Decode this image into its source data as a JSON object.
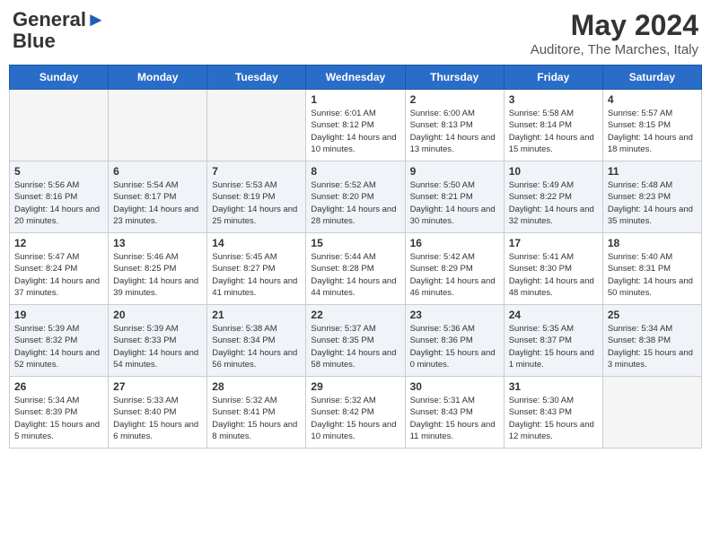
{
  "header": {
    "logo_line1": "General",
    "logo_line2": "Blue",
    "month_year": "May 2024",
    "location": "Auditore, The Marches, Italy"
  },
  "days_of_week": [
    "Sunday",
    "Monday",
    "Tuesday",
    "Wednesday",
    "Thursday",
    "Friday",
    "Saturday"
  ],
  "weeks": [
    [
      {
        "day": "",
        "empty": true
      },
      {
        "day": "",
        "empty": true
      },
      {
        "day": "",
        "empty": true
      },
      {
        "day": "1",
        "sunrise": "6:01 AM",
        "sunset": "8:12 PM",
        "daylight": "14 hours and 10 minutes."
      },
      {
        "day": "2",
        "sunrise": "6:00 AM",
        "sunset": "8:13 PM",
        "daylight": "14 hours and 13 minutes."
      },
      {
        "day": "3",
        "sunrise": "5:58 AM",
        "sunset": "8:14 PM",
        "daylight": "14 hours and 15 minutes."
      },
      {
        "day": "4",
        "sunrise": "5:57 AM",
        "sunset": "8:15 PM",
        "daylight": "14 hours and 18 minutes."
      }
    ],
    [
      {
        "day": "5",
        "sunrise": "5:56 AM",
        "sunset": "8:16 PM",
        "daylight": "14 hours and 20 minutes."
      },
      {
        "day": "6",
        "sunrise": "5:54 AM",
        "sunset": "8:17 PM",
        "daylight": "14 hours and 23 minutes."
      },
      {
        "day": "7",
        "sunrise": "5:53 AM",
        "sunset": "8:19 PM",
        "daylight": "14 hours and 25 minutes."
      },
      {
        "day": "8",
        "sunrise": "5:52 AM",
        "sunset": "8:20 PM",
        "daylight": "14 hours and 28 minutes."
      },
      {
        "day": "9",
        "sunrise": "5:50 AM",
        "sunset": "8:21 PM",
        "daylight": "14 hours and 30 minutes."
      },
      {
        "day": "10",
        "sunrise": "5:49 AM",
        "sunset": "8:22 PM",
        "daylight": "14 hours and 32 minutes."
      },
      {
        "day": "11",
        "sunrise": "5:48 AM",
        "sunset": "8:23 PM",
        "daylight": "14 hours and 35 minutes."
      }
    ],
    [
      {
        "day": "12",
        "sunrise": "5:47 AM",
        "sunset": "8:24 PM",
        "daylight": "14 hours and 37 minutes."
      },
      {
        "day": "13",
        "sunrise": "5:46 AM",
        "sunset": "8:25 PM",
        "daylight": "14 hours and 39 minutes."
      },
      {
        "day": "14",
        "sunrise": "5:45 AM",
        "sunset": "8:27 PM",
        "daylight": "14 hours and 41 minutes."
      },
      {
        "day": "15",
        "sunrise": "5:44 AM",
        "sunset": "8:28 PM",
        "daylight": "14 hours and 44 minutes."
      },
      {
        "day": "16",
        "sunrise": "5:42 AM",
        "sunset": "8:29 PM",
        "daylight": "14 hours and 46 minutes."
      },
      {
        "day": "17",
        "sunrise": "5:41 AM",
        "sunset": "8:30 PM",
        "daylight": "14 hours and 48 minutes."
      },
      {
        "day": "18",
        "sunrise": "5:40 AM",
        "sunset": "8:31 PM",
        "daylight": "14 hours and 50 minutes."
      }
    ],
    [
      {
        "day": "19",
        "sunrise": "5:39 AM",
        "sunset": "8:32 PM",
        "daylight": "14 hours and 52 minutes."
      },
      {
        "day": "20",
        "sunrise": "5:39 AM",
        "sunset": "8:33 PM",
        "daylight": "14 hours and 54 minutes."
      },
      {
        "day": "21",
        "sunrise": "5:38 AM",
        "sunset": "8:34 PM",
        "daylight": "14 hours and 56 minutes."
      },
      {
        "day": "22",
        "sunrise": "5:37 AM",
        "sunset": "8:35 PM",
        "daylight": "14 hours and 58 minutes."
      },
      {
        "day": "23",
        "sunrise": "5:36 AM",
        "sunset": "8:36 PM",
        "daylight": "15 hours and 0 minutes."
      },
      {
        "day": "24",
        "sunrise": "5:35 AM",
        "sunset": "8:37 PM",
        "daylight": "15 hours and 1 minute."
      },
      {
        "day": "25",
        "sunrise": "5:34 AM",
        "sunset": "8:38 PM",
        "daylight": "15 hours and 3 minutes."
      }
    ],
    [
      {
        "day": "26",
        "sunrise": "5:34 AM",
        "sunset": "8:39 PM",
        "daylight": "15 hours and 5 minutes."
      },
      {
        "day": "27",
        "sunrise": "5:33 AM",
        "sunset": "8:40 PM",
        "daylight": "15 hours and 6 minutes."
      },
      {
        "day": "28",
        "sunrise": "5:32 AM",
        "sunset": "8:41 PM",
        "daylight": "15 hours and 8 minutes."
      },
      {
        "day": "29",
        "sunrise": "5:32 AM",
        "sunset": "8:42 PM",
        "daylight": "15 hours and 10 minutes."
      },
      {
        "day": "30",
        "sunrise": "5:31 AM",
        "sunset": "8:43 PM",
        "daylight": "15 hours and 11 minutes."
      },
      {
        "day": "31",
        "sunrise": "5:30 AM",
        "sunset": "8:43 PM",
        "daylight": "15 hours and 12 minutes."
      },
      {
        "day": "",
        "empty": true
      }
    ]
  ],
  "labels": {
    "sunrise": "Sunrise:",
    "sunset": "Sunset:",
    "daylight": "Daylight hours"
  }
}
